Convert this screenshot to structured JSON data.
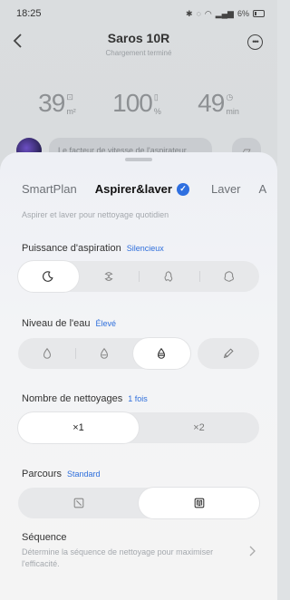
{
  "status_bar": {
    "time": "18:25",
    "battery": "6%"
  },
  "device": {
    "name": "Saros 10R",
    "status": "Chargement terminé"
  },
  "stats": [
    {
      "value": "39",
      "unit": "m²"
    },
    {
      "value": "100",
      "unit": "%"
    },
    {
      "value": "49",
      "unit": "min"
    }
  ],
  "message": {
    "text": "Le facteur de vitesse de l'aspirateur"
  },
  "mode_tabs": [
    {
      "label": "SmartPlan"
    },
    {
      "label": "Aspirer&laver",
      "active": true
    },
    {
      "label": "Laver"
    },
    {
      "label": "A"
    }
  ],
  "mode_description": "Aspirer et laver pour nettoyage quotidien",
  "suction": {
    "label": "Puissance d'aspiration",
    "value": "Silencieux",
    "options": [
      "moon-icon",
      "swirl-icon",
      "fan-icon",
      "turbo-icon"
    ],
    "selected_index": 0
  },
  "water": {
    "label": "Niveau de l'eau",
    "value": "Élevé",
    "options": [
      "drop-low-icon",
      "drop-medium-icon",
      "drop-high-icon"
    ],
    "selected_index": 2,
    "custom_icon": "pencil-icon"
  },
  "passes": {
    "label": "Nombre de nettoyages",
    "value": "1 fois",
    "options": [
      "×1",
      "×2"
    ],
    "selected_index": 0
  },
  "route": {
    "label": "Parcours",
    "value": "Standard",
    "options": [
      "route-simple-icon",
      "route-deep-icon"
    ],
    "selected_index": 1
  },
  "sequence": {
    "title": "Séquence",
    "description": "Détermine la séquence de nettoyage pour maximiser l'efficacité."
  },
  "colors": {
    "accent": "#2f6fdc",
    "selected_bg": "#ffffff",
    "segment_bg": "#e7e8ea"
  }
}
